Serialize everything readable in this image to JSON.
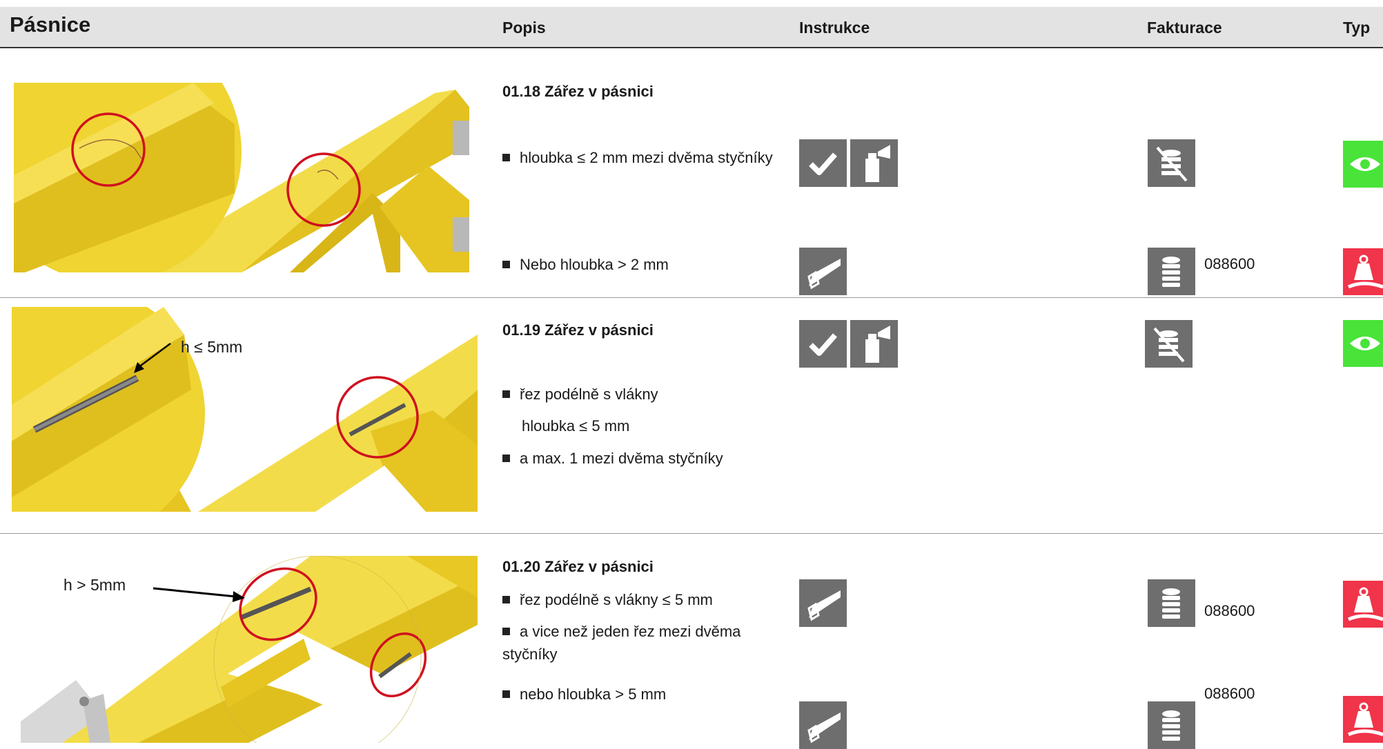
{
  "header": {
    "title": "Pásnice",
    "col_popis": "Popis",
    "col_instrukce": "Instrukce",
    "col_fakturace": "Fakturace",
    "col_typ": "Typ"
  },
  "sections": [
    {
      "title": "01.18 Zářez v pásnici",
      "items": [
        {
          "text": "hloubka ≤ 2 mm mezi dvěma styčníky",
          "instr": [
            "check-icon",
            "spray-icon"
          ],
          "billing": "no-billing-icon",
          "code": "",
          "typ": "eye-icon"
        },
        {
          "text": "Nebo hloubka > 2 mm",
          "instr": [
            "saw-icon"
          ],
          "billing": "coins-icon",
          "code": "088600",
          "typ": "weight-icon"
        }
      ]
    },
    {
      "title": "01.19 Zářez v pásnici",
      "label": "h ≤ 5mm",
      "items": [
        {
          "text": "řez podélně s vlákny",
          "instr": [
            "check-icon",
            "spray-icon"
          ],
          "billing": "no-billing-icon",
          "code": "",
          "typ": "eye-icon"
        },
        {
          "text": "hloubka ≤ 5 mm"
        },
        {
          "text": "a max. 1 mezi dvěma styčníky"
        }
      ]
    },
    {
      "title": "01.20 Zářez v pásnici",
      "label": "h > 5mm",
      "items": [
        {
          "text": "řez podélně s vlákny ≤ 5 mm",
          "instr": [
            "saw-icon"
          ],
          "billing": "coins-icon",
          "code": "088600",
          "typ": "weight-icon"
        },
        {
          "text": "a vice než jeden řez mezi dvěma styčníky"
        },
        {
          "text": "nebo hloubka > 5 mm",
          "instr": [
            "saw-icon"
          ],
          "billing": "coins-icon",
          "code": "088600",
          "typ": "weight-icon"
        }
      ]
    }
  ],
  "colors": {
    "eye_bg": "#49e33a",
    "weight_bg": "#f0344a",
    "icon_bg": "#6e6e6e",
    "wood": "#f2d42a",
    "circle": "#d01020"
  }
}
